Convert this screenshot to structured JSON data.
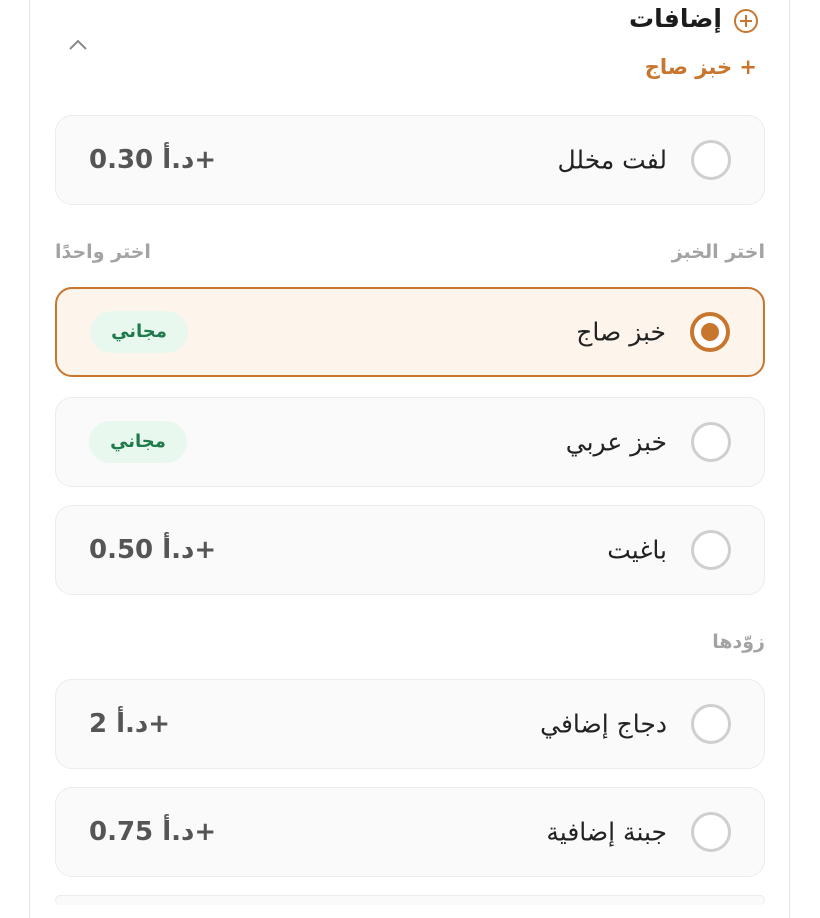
{
  "extras_section": {
    "title": "إضافات",
    "selected_summary": "+ خبز صاج",
    "icon": "plus-circle-icon",
    "collapse_icon": "chevron-up-icon"
  },
  "pickle_option": {
    "label": "لفت مخلل",
    "price": "+د.أ 0.30"
  },
  "bread_group": {
    "title": "اختر الخبز",
    "hint": "اختر واحدًا",
    "options": [
      {
        "label": "خبز صاج",
        "badge": "مجاني",
        "selected": true
      },
      {
        "label": "خبز عربي",
        "badge": "مجاني",
        "selected": false
      },
      {
        "label": "باغيت",
        "price": "+د.أ 0.50",
        "selected": false
      }
    ]
  },
  "extra_group": {
    "title": "زوّدها",
    "options": [
      {
        "label": "دجاج إضافي",
        "price": "+د.أ 2"
      },
      {
        "label": "جبنة إضافية",
        "price": "+د.أ 0.75"
      }
    ]
  },
  "colors": {
    "accent": "#c8762e",
    "free_badge_bg": "#e9f8ef",
    "free_badge_text": "#1f7a4a",
    "muted": "#a3a3a3"
  }
}
